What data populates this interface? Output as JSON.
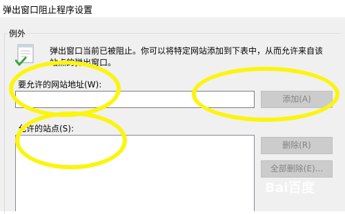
{
  "window": {
    "title": "弹出窗口阻止程序设置"
  },
  "exceptions": {
    "legend": "例外",
    "info_line1": "弹出窗口当前已被阻止。你可以将特定网站添加到下表中，从而允许来自该",
    "info_line2": "站点的弹出窗口。",
    "address_label": "要允许的网站地址(W):",
    "address_value": "",
    "add_label": "添加(A)",
    "allowed_label": "允许的站点(S):",
    "allowed_sites": [],
    "remove_label": "删除(R)",
    "remove_all_label": "全部删除(E)..."
  },
  "annotations": {
    "highlight_color": "#fbf50d"
  },
  "watermark": {
    "text": "Bai百度"
  }
}
